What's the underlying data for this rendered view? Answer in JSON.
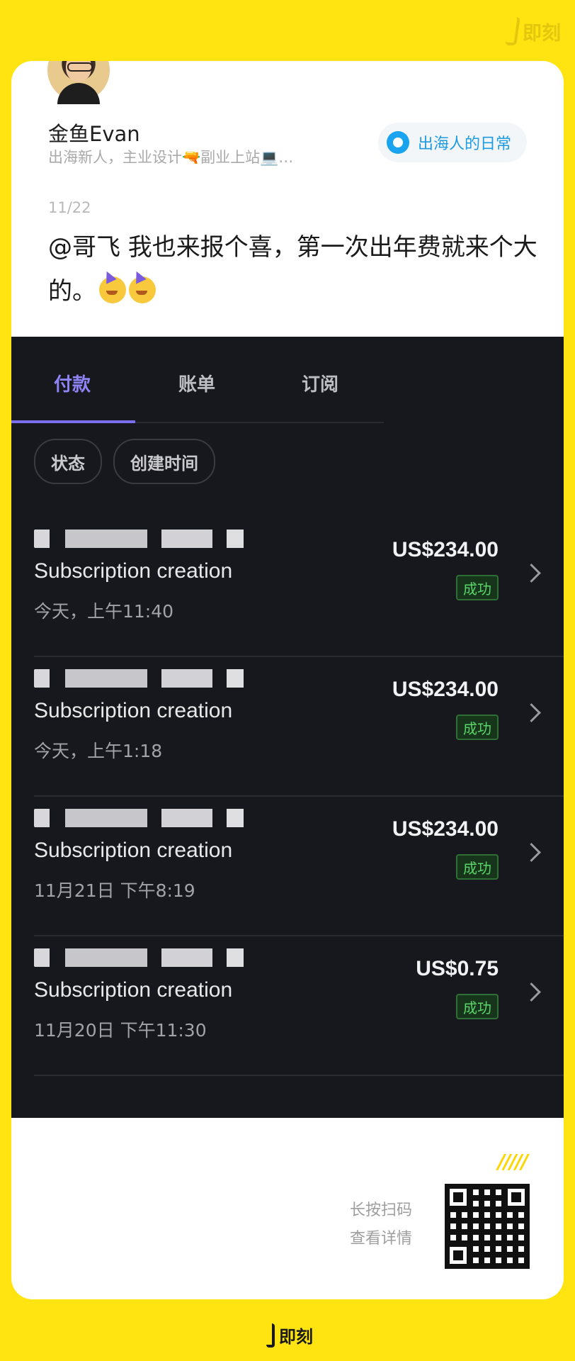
{
  "brand": {
    "name": "即刻"
  },
  "post": {
    "author_name": "金鱼Evan",
    "author_bio": "出海新人，主业设计🔫副业上站💻…",
    "topic": "出海人的日常",
    "date": "11/22",
    "text": "@哥飞 我也来报个喜，第一次出年费就来个大的。"
  },
  "screenshot": {
    "tabs": [
      {
        "label": "付款",
        "active": true
      },
      {
        "label": "账单",
        "active": false
      },
      {
        "label": "订阅",
        "active": false
      }
    ],
    "filters": [
      "状态",
      "创建时间"
    ],
    "transactions": [
      {
        "title": "Subscription creation",
        "time": "今天，上午11:40",
        "amount": "US$234.00",
        "status": "成功"
      },
      {
        "title": "Subscription creation",
        "time": "今天，上午1:18",
        "amount": "US$234.00",
        "status": "成功"
      },
      {
        "title": "Subscription creation",
        "time": "11月21日 下午8:19",
        "amount": "US$234.00",
        "status": "成功"
      },
      {
        "title": "Subscription creation",
        "time": "11月20日 下午11:30",
        "amount": "US$0.75",
        "status": "成功"
      }
    ]
  },
  "footer": {
    "scan_line1": "长按扫码",
    "scan_line2": "查看详情",
    "decoration": "/////"
  },
  "colors": {
    "background": "#FFE411",
    "accent_tab": "#8E84F5",
    "success": "#5BD46A",
    "topic": "#1E9BE0"
  }
}
